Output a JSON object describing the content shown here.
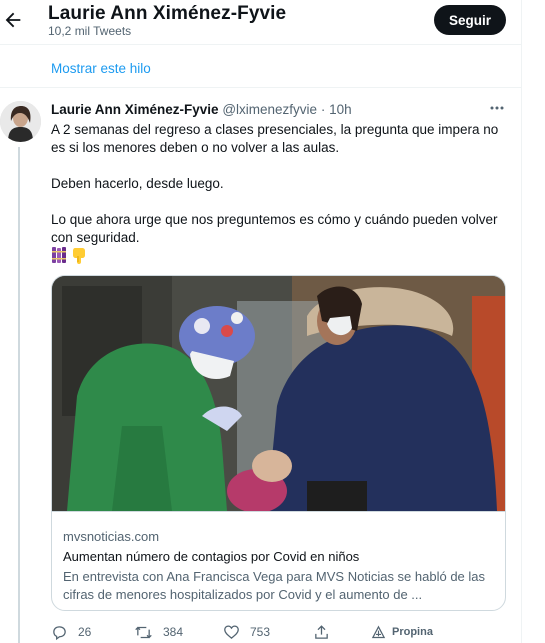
{
  "header": {
    "name": "Laurie Ann Ximénez-Fyvie",
    "tweets_count": "10,2 mil Tweets",
    "follow_label": "Seguir"
  },
  "thread": {
    "show_thread_label": "Mostrar este hilo"
  },
  "tweet": {
    "author_name": "Laurie Ann Ximénez-Fyvie",
    "handle": "@lximenezfyvie",
    "separator": "·",
    "time": "10h",
    "paragraphs": [
      "A 2 semanas del regreso a clases presenciales, la pregunta que impera no es si los menores deben o no volver a las aulas.",
      "Deben hacerlo, desde luego.",
      "Lo que ahora urge que nos preguntemos es cómo y cuándo pueden volver con seguridad."
    ],
    "emojis": [
      "books-emoji",
      "point-down-emoji"
    ]
  },
  "card": {
    "domain": "mvsnoticias.com",
    "title": "Aumentan número de contagios por Covid en niños",
    "description": "En entrevista con Ana Francisca Vega para MVS Noticias se habló de las cifras de menores hospitalizados por Covid y el aumento de ..."
  },
  "actions": {
    "replies": "26",
    "retweets": "384",
    "likes": "753",
    "tip_label": "Propina"
  },
  "colors": {
    "accent": "#1d9bf0",
    "text": "#0f1419",
    "secondary": "#536471",
    "border": "#cfd9de"
  }
}
